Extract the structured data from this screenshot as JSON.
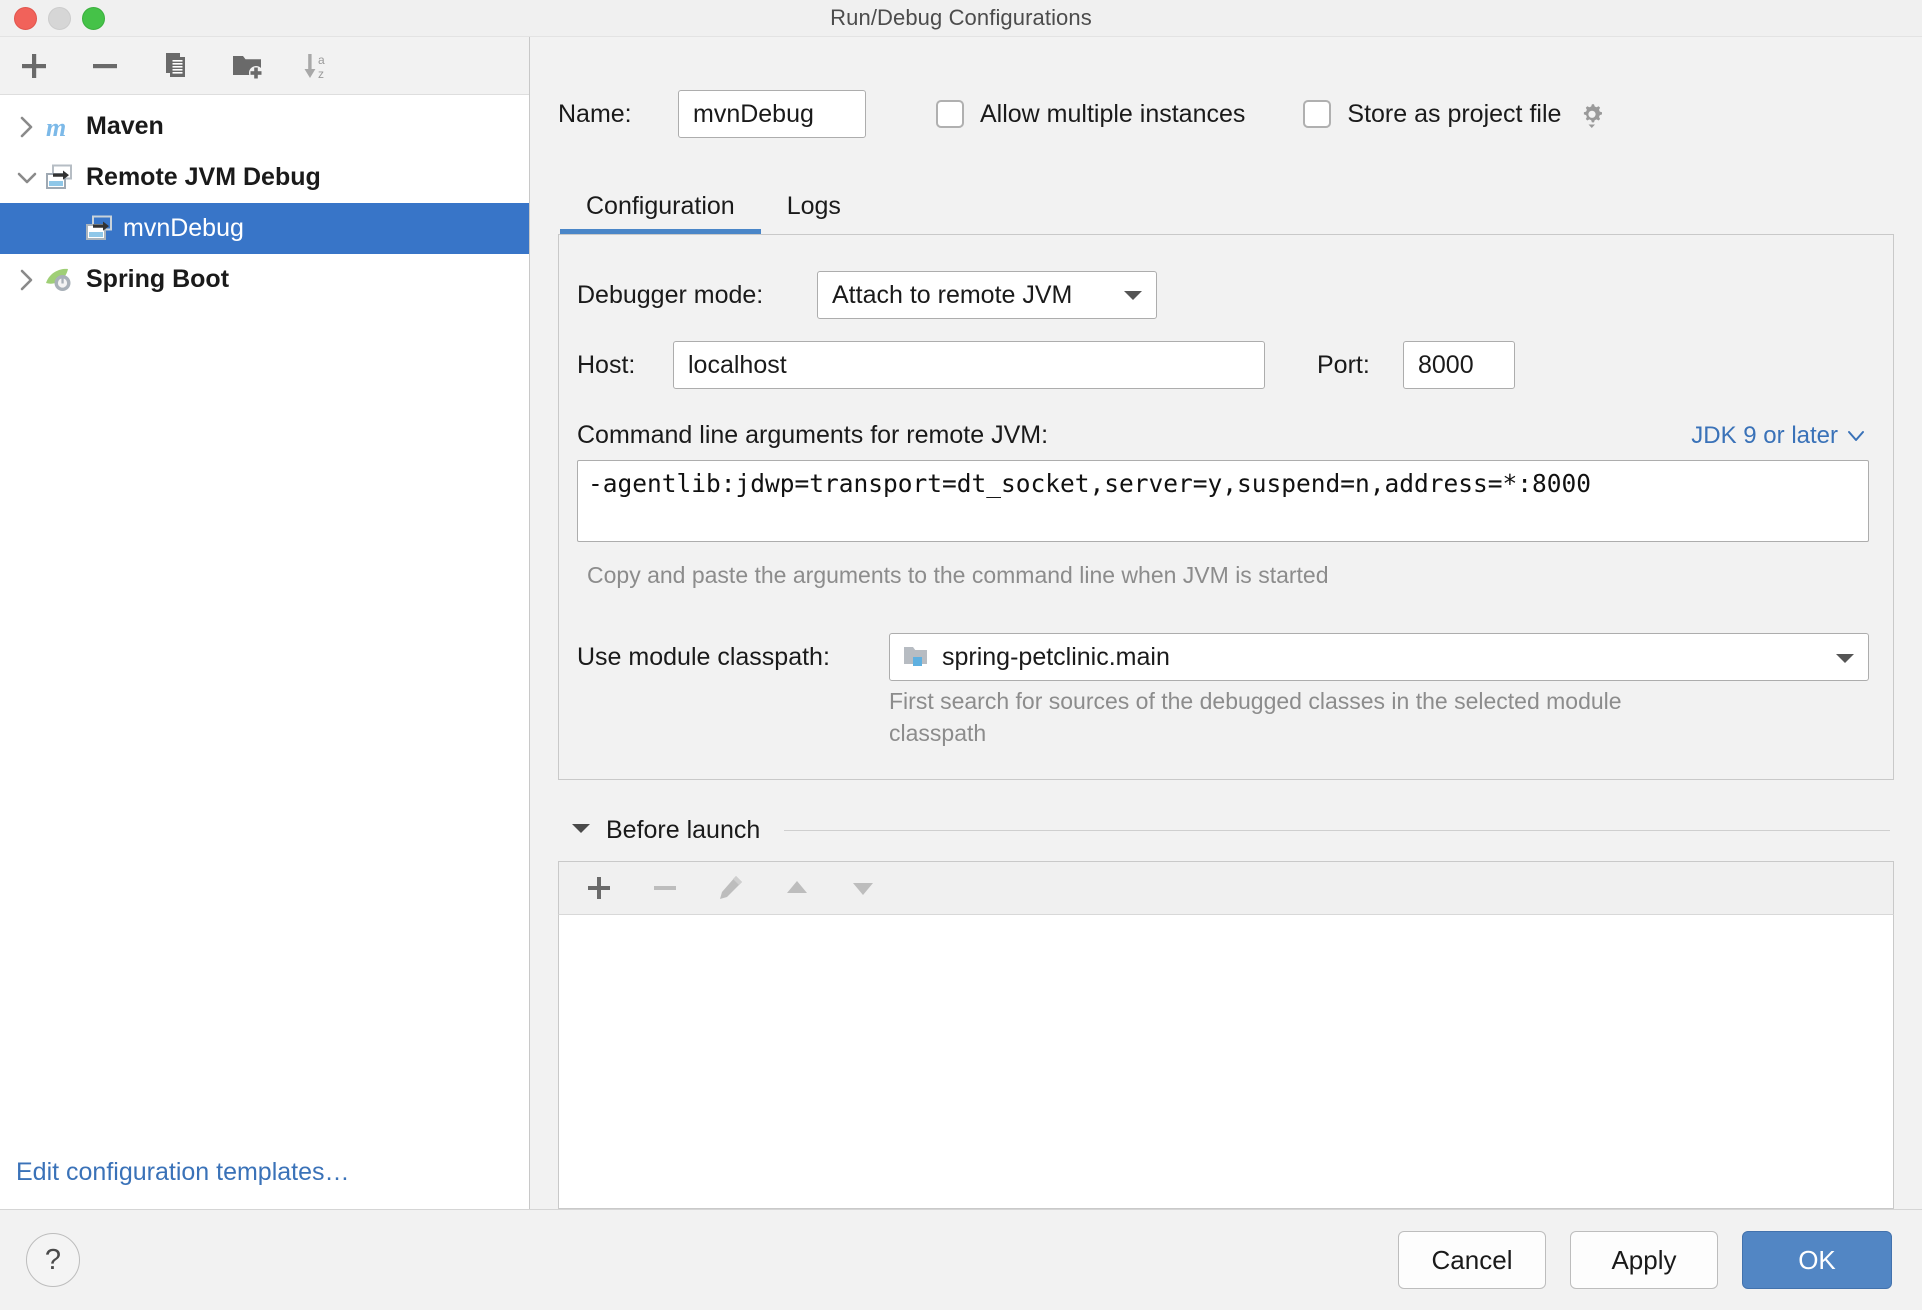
{
  "window": {
    "title": "Run/Debug Configurations",
    "traffic_lights": [
      "close",
      "minimize",
      "zoom"
    ]
  },
  "sidebar": {
    "toolbar": [
      {
        "name": "add",
        "icon": "plus-icon",
        "enabled": true
      },
      {
        "name": "remove",
        "icon": "minus-icon",
        "enabled": true
      },
      {
        "name": "copy",
        "icon": "copy-icon",
        "enabled": true
      },
      {
        "name": "save-to-folder",
        "icon": "folder-add-icon",
        "enabled": true
      },
      {
        "name": "sort-alphabetically",
        "icon": "sort-az-icon",
        "enabled": true
      }
    ],
    "tree": [
      {
        "label": "Maven",
        "icon": "maven-icon",
        "expanded": false,
        "level": 0,
        "selected": false
      },
      {
        "label": "Remote JVM Debug",
        "icon": "remote-jvm-debug-icon",
        "expanded": true,
        "level": 0,
        "selected": false
      },
      {
        "label": "mvnDebug",
        "icon": "remote-jvm-debug-icon",
        "level": 1,
        "selected": true
      },
      {
        "label": "Spring Boot",
        "icon": "spring-boot-icon",
        "expanded": false,
        "level": 0,
        "selected": false
      }
    ],
    "edit_templates_link": "Edit configuration templates…"
  },
  "form": {
    "name_label": "Name:",
    "name_value": "mvnDebug",
    "name_placeholder": "Name",
    "allow_multiple_instances": {
      "label": "Allow multiple instances",
      "checked": false
    },
    "store_as_project_file": {
      "label": "Store as project file",
      "checked": false
    },
    "gear_icon": "gear-icon"
  },
  "tabs": [
    {
      "label": "Configuration",
      "active": true
    },
    {
      "label": "Logs",
      "active": false
    }
  ],
  "configuration": {
    "debugger_mode_label": "Debugger mode:",
    "debugger_mode_value": "Attach to remote JVM",
    "host_label": "Host:",
    "host_value": "localhost",
    "host_placeholder": "Host",
    "port_label": "Port:",
    "port_value": "8000",
    "port_placeholder": "Port",
    "args_label": "Command line arguments for remote JVM:",
    "jdk_selector": "JDK 9 or later",
    "args_value": "-agentlib:jdwp=transport=dt_socket,server=y,suspend=n,address=*:8000",
    "args_hint": "Copy and paste the arguments to the command line when JVM is started",
    "classpath_label": "Use module classpath:",
    "classpath_value": "spring-petclinic.main",
    "classpath_hint": "First search for sources of the debugged classes in the selected module classpath"
  },
  "before_launch": {
    "title": "Before launch",
    "expanded": true,
    "toolbar": [
      {
        "name": "add-task",
        "icon": "plus-icon",
        "enabled": true
      },
      {
        "name": "remove-task",
        "icon": "minus-icon",
        "enabled": false
      },
      {
        "name": "edit-task",
        "icon": "pencil-icon",
        "enabled": false
      },
      {
        "name": "move-up",
        "icon": "arrow-up-icon",
        "enabled": false
      },
      {
        "name": "move-down",
        "icon": "arrow-down-icon",
        "enabled": false
      }
    ],
    "items": []
  },
  "footer": {
    "help_label": "?",
    "cancel_label": "Cancel",
    "apply_label": "Apply",
    "ok_label": "OK"
  },
  "colors": {
    "accent": "#3875c8",
    "primary_button": "#5286c4",
    "link": "#3a72b8",
    "tab_underline": "#4a86c8",
    "window_bg": "#f2f2f2"
  }
}
